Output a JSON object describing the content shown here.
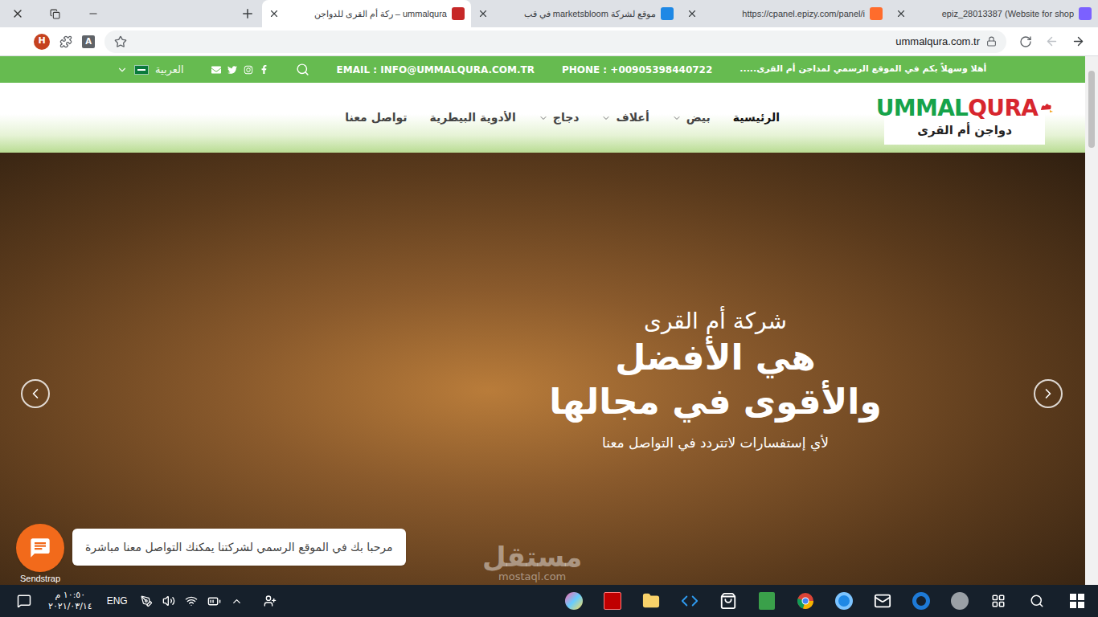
{
  "browser": {
    "tabs": [
      {
        "title": "ummalqura – ركة أم القرى للدواجن",
        "selected": true,
        "favicon_color": "#c62828"
      },
      {
        "title": "موقع لشركة marketsbloom في قب",
        "selected": false,
        "favicon_color": "#1e88e5"
      },
      {
        "title": "https://cpanel.epizy.com/panel/i",
        "selected": false,
        "favicon_color": "#ff6c2c"
      },
      {
        "title": "epiz_28013387 (Website for shop",
        "selected": false,
        "favicon_color": "#7b61ff"
      }
    ],
    "profile_initial": "H",
    "translate_badge": "A",
    "url": "ummalqura.com.tr",
    "back_enabled": true,
    "forward_enabled": false
  },
  "topbar": {
    "language": "العربية",
    "email": "EMAIL : INFO@UMMALQURA.COM.TR",
    "phone": "PHONE : +00905398440722",
    "welcome": "أهلا وسهلاً بكم في الموقع الرسمي لمداجن أم القرى....."
  },
  "logo": {
    "parts": [
      {
        "text": "UMMAL",
        "color": "#16a34a"
      },
      {
        "text": "QURA",
        "color": "#d7262e"
      }
    ],
    "arabic": "دواجن أم القرى"
  },
  "nav": [
    {
      "label": "الرئيسية",
      "has_dropdown": false,
      "selected": true
    },
    {
      "label": "بيض",
      "has_dropdown": true,
      "selected": false
    },
    {
      "label": "أعلاف",
      "has_dropdown": true,
      "selected": false
    },
    {
      "label": "دجاج",
      "has_dropdown": true,
      "selected": false
    },
    {
      "label": "الأدوية البيطرية",
      "has_dropdown": false,
      "selected": false
    },
    {
      "label": "تواصل معنا",
      "has_dropdown": false,
      "selected": false
    }
  ],
  "hero": {
    "subtitle": "شركة أم القرى",
    "title_lines": [
      "هي الأفضل",
      "والأقوى في مجالها"
    ],
    "caption": "لأي إستفسارات لاتتردد في التواصل معنا"
  },
  "chat": {
    "label": "Sendstrap",
    "message": "مرحبا بك في الموقع الرسمي لشركتنا يمكنك التواصل معنا مباشرة"
  },
  "watermark": {
    "arabic": "مستقل",
    "latin": "mostaql.com"
  },
  "taskbar": {
    "time": "١٠:٥٠ م",
    "date": "٢٠٢١/٠٣/١٤",
    "language": "ENG"
  }
}
